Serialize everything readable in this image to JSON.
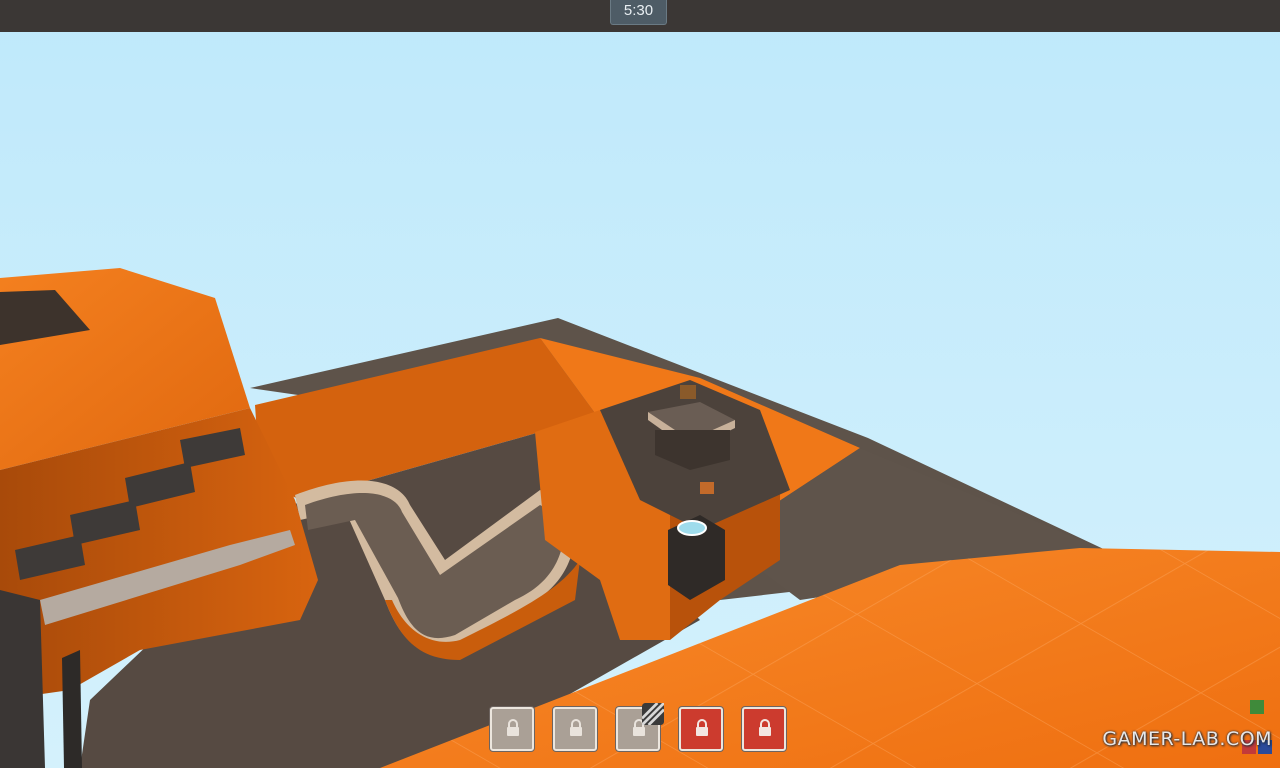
{
  "hud": {
    "timer": "5:30"
  },
  "control_points": [
    {
      "state": "locked",
      "color": "#aaa096",
      "contested": false
    },
    {
      "state": "locked",
      "color": "#aaa096",
      "contested": false
    },
    {
      "state": "locked",
      "color": "#aaa096",
      "contested": true
    },
    {
      "state": "locked",
      "color": "#cc3b2e",
      "contested": false
    },
    {
      "state": "locked",
      "color": "#cc3b2e",
      "contested": false
    }
  ],
  "watermark": {
    "text": "GAMER-LAB.COM"
  },
  "colors": {
    "sky": "#c8ecfb",
    "orange": "#ef7418",
    "floor": "#5a4e45",
    "team_red": "#cc3b2e",
    "neutral": "#aaa096"
  },
  "icons": {
    "lock": "lock-icon",
    "contested": "striped-flag-icon"
  }
}
